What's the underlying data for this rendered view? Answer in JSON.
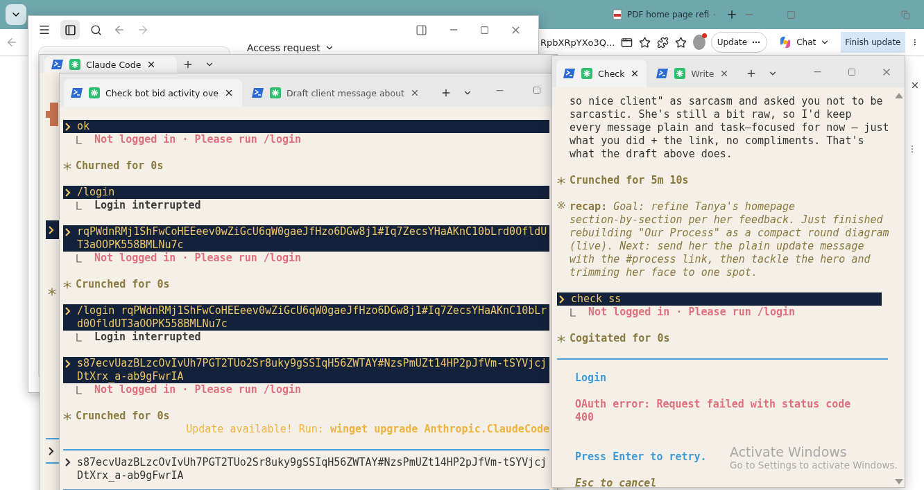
{
  "browser": {
    "tabs": [
      {
        "label": "PDF home page refi",
        "selected": false
      }
    ],
    "address": "RpbXRpYXo3Q...",
    "update_button": "Update",
    "chat_button": "Chat",
    "finish_update": "Finish update"
  },
  "claude_app": {
    "heading": "Access request"
  },
  "back_terminal": {
    "tabs": [
      {
        "label": "Claude Code",
        "selected": true
      }
    ],
    "edge_marks": [
      {
        "kind": "prompt"
      },
      {
        "kind": "status"
      },
      {
        "kind": "input"
      }
    ]
  },
  "main_terminal": {
    "tabs": [
      {
        "label": "Check bot bid activity ove",
        "selected": true
      },
      {
        "label": "Draft client message about",
        "selected": false
      }
    ],
    "lines": [
      {
        "kind": "prompt",
        "text": "ok"
      },
      {
        "kind": "error",
        "text": "Not logged in · Please run /login"
      },
      {
        "kind": "status",
        "text": "Churned for 0s"
      },
      {
        "kind": "prompt",
        "text": "/login"
      },
      {
        "kind": "result",
        "text": "Login interrupted"
      },
      {
        "kind": "prompt",
        "text": "rqPWdnRMj1ShFwCoHEEeev0wZiGcU6qW0gaeJfHzo6DGw8j1#Iq7ZecsYHaAKnC10bLrd0OfldUT3aOOPK558BMLNu7c"
      },
      {
        "kind": "error",
        "text": "Not logged in · Please run /login"
      },
      {
        "kind": "status",
        "text": "Crunched for 0s"
      },
      {
        "kind": "prompt",
        "text": "/login rqPWdnRMj1ShFwCoHEEeev0wZiGcU6qW0gaeJfHzo6DGw8j1#Iq7ZecsYHaAKnC10bLrd0OfldUT3aOOPK558BMLNu7c"
      },
      {
        "kind": "result",
        "text": "Login interrupted"
      },
      {
        "kind": "prompt",
        "text": "s87ecvUazBLzcOvIvUh7PGT2TUo2Sr8uky9gSSIqH56ZWTAY#NzsPmUZt14HP2pJfVm-tSYVjcjDtXrx_a-ab9gFwrIA"
      },
      {
        "kind": "error",
        "text": "Not logged in · Please run /login"
      },
      {
        "kind": "status",
        "text": "Crunched for 0s"
      },
      {
        "kind": "notice",
        "text": "Update available! Run: **winget upgrade Anthropic.ClaudeCode**"
      }
    ],
    "input": {
      "value": "s87ecvUazBLzcOvIvUh7PGT2TUo2Sr8uky9gSSIqH56ZWTAY#NzsPmUZt14HP2pJfVm-tSYVjcjDtXrx_a-ab9gFwrIA"
    }
  },
  "side_terminal": {
    "tabs": [
      {
        "label": "Check",
        "selected": true
      },
      {
        "label": "Write",
        "selected": false
      }
    ],
    "lines": [
      {
        "kind": "text",
        "text": "so nice client\" as sarcasm and asked you not to be\nsarcastic. She's still a bit raw, so I'd keep\nevery message plain and task—focused for now — just\nwhat you did + the link, no compliments. That's\nwhat the draft above does."
      },
      {
        "kind": "status",
        "text": "Crunched for 5m 10s"
      },
      {
        "kind": "recap",
        "text": "**recap:** *Goal: refine Tanya's homepage\nsection-by-section per her feedback. Just finished\nrebuilding \"Our Process\" as a compact round diagram\n(live). Next: send her the plain update message\nwith the #process link, then tackle the hero and\ntrimming her face to one spot.*"
      },
      {
        "kind": "prompt",
        "text": "check ss"
      },
      {
        "kind": "error",
        "text": "Not logged in · Please run /login"
      },
      {
        "kind": "status",
        "text": "Cogitated for 0s"
      }
    ],
    "login": {
      "title": "Login",
      "error": "OAuth error: Request failed with status code 400",
      "retry": "Press Enter to retry.",
      "cancel": "Esc to cancel"
    }
  },
  "activation_notice": {
    "title": "Activate Windows",
    "subtitle": "Go to Settings to activate Windows."
  }
}
